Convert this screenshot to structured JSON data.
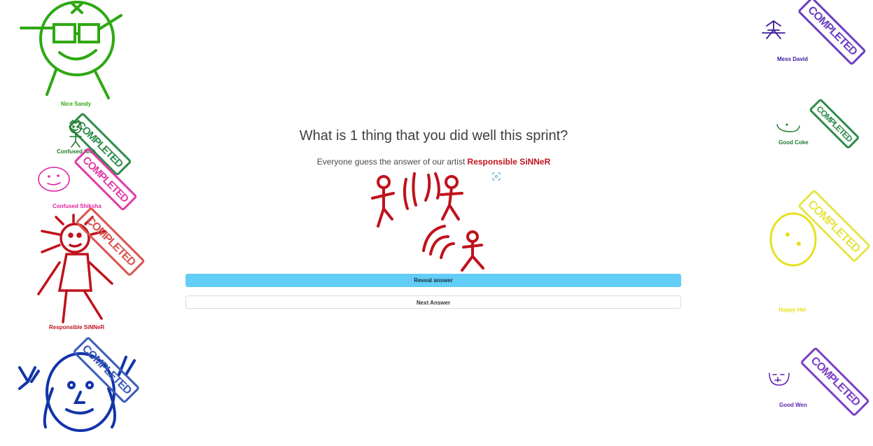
{
  "question": {
    "text": "What is 1 thing that you did well this sprint?"
  },
  "prompt": {
    "prefix": "Everyone guess the answer of our artist",
    "artist": "Responsible SiNNeR",
    "artist_color": "#c0121d"
  },
  "buttons": {
    "reveal": "Reveal answer",
    "next": "Next Answer"
  },
  "stamp_text": "COMPLETED",
  "icons": {
    "fullscreen": "expand-icon"
  },
  "players": [
    {
      "name": "Nice Sandy",
      "color": "#2fa812",
      "completed": true
    },
    {
      "name": "Confused Nick",
      "color": "#1f7a2b",
      "completed": true
    },
    {
      "name": "Confused Shiksha",
      "color": "#e023a4",
      "completed": true
    },
    {
      "name": "Responsible SiNNeR",
      "color": "#c0121d",
      "completed": true
    },
    {
      "name": "",
      "color": "#1234a8",
      "completed": true
    },
    {
      "name": "Mess David",
      "color": "#3d1a9c",
      "completed": true
    },
    {
      "name": "Good Coke",
      "color": "#1f7a2b",
      "completed": true
    },
    {
      "name": "Happy Hei",
      "color": "#e6e020",
      "completed": true
    },
    {
      "name": "Good Wen",
      "color": "#5a1fb0",
      "completed": true
    }
  ]
}
